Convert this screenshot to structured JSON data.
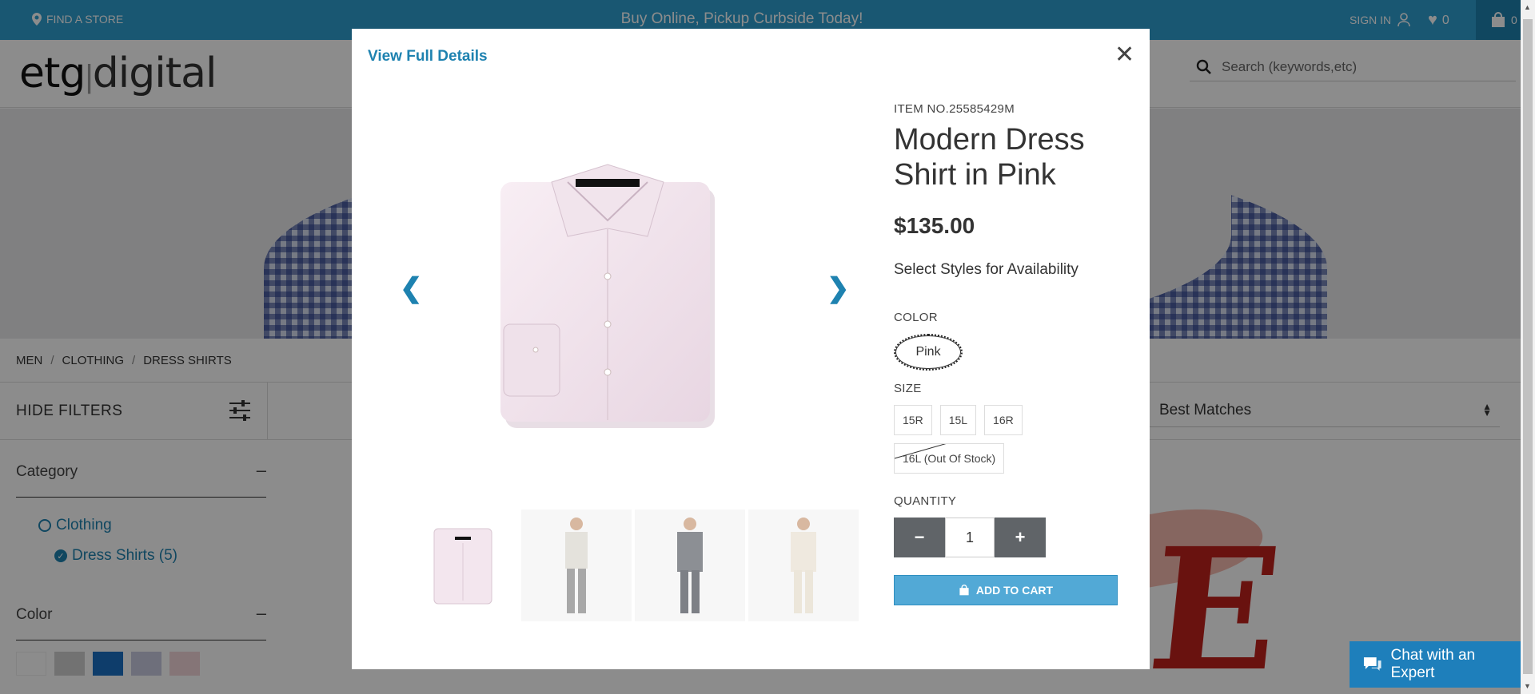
{
  "topbar": {
    "find_store": "FIND A STORE",
    "promo": "Buy Online, Pickup Curbside Today!",
    "sign_in": "SIGN IN",
    "wishlist_count": "0",
    "cart_count": "0"
  },
  "header": {
    "logo_main": "etg",
    "logo_sep": "|",
    "logo_sub": "digital",
    "search_placeholder": "Search (keywords,etc)"
  },
  "breadcrumb": [
    "MEN",
    "CLOTHING",
    "DRESS SHIRTS"
  ],
  "filterbar": {
    "hide_filters": "HIDE FILTERS",
    "sort_value": "Best Matches"
  },
  "sidebar": {
    "category_title": "Category",
    "category_items": [
      {
        "label": "Clothing"
      },
      {
        "label": "Dress Shirts (5)"
      }
    ],
    "color_title": "Color",
    "swatch_colors": [
      "#ffffff",
      "#cfcfcf",
      "#1a6fc4",
      "#c9cbe0",
      "#f2d6d9"
    ]
  },
  "modal": {
    "view_full_details": "View Full Details",
    "item_no": "ITEM NO.25585429M",
    "title": "Modern Dress Shirt in Pink",
    "price": "$135.00",
    "availability": "Select Styles for Availability",
    "color_label": "COLOR",
    "color_value": "Pink",
    "size_label": "SIZE",
    "sizes": [
      "15R",
      "15L",
      "16R",
      "16L (Out Of Stock)"
    ],
    "quantity_label": "QUANTITY",
    "quantity": "1",
    "add_to_cart": "ADD TO CART"
  },
  "chat": {
    "label": "Chat with an Expert"
  },
  "colors": {
    "brand_blue": "#2f9fd0",
    "link_blue": "#1e82b0",
    "shirt_pink": "#f3e6ee"
  }
}
